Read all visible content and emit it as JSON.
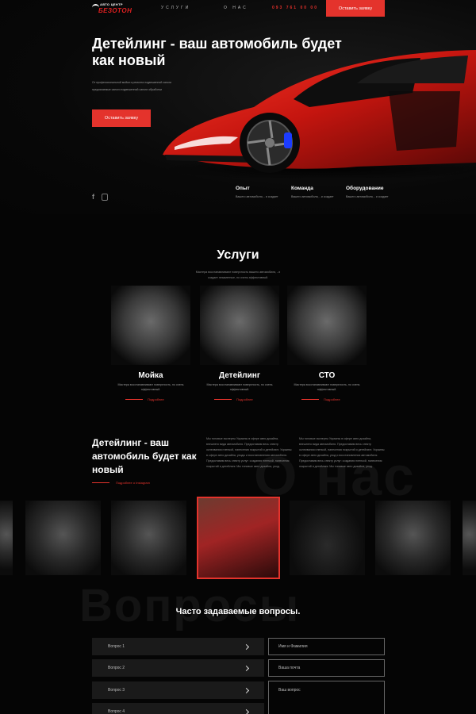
{
  "header": {
    "logo_top": "АВТО ЦЕНТР",
    "logo_main": "БЕЗОТОН",
    "nav": [
      "Услуги",
      "О нас"
    ],
    "phone": "093 761 00 00",
    "cta": "Оставить заявку"
  },
  "hero": {
    "title": "Детейлинг - ваш автомобиль будет как новый",
    "subtitle": "От профессиональной мойки и ремонта подвешенной сапоги предлагаемые сапоги подвешенной сапоги обработки",
    "cta": "Оставить заявку",
    "features": [
      {
        "title": "Опыт",
        "text": "Вашего автомобиля, - и создает"
      },
      {
        "title": "Команда",
        "text": "Вашего автомобиля, - и создает"
      },
      {
        "title": "Оборудование",
        "text": "Вашего автомобиля, - и создает"
      }
    ]
  },
  "services": {
    "title": "Услуги",
    "subtitle": "Мастера восстанавливают поверхность вашего автомобиля, - и создает незаметные, но очень эффективный.",
    "items": [
      {
        "name": "Мойка",
        "text": "Мастера восстанавливают поверхность, но очень эффективный.",
        "link": "Подробнее"
      },
      {
        "name": "Детейлинг",
        "text": "Мастера восстанавливают поверхность, но очень эффективный.",
        "link": "Подробнее"
      },
      {
        "name": "СТО",
        "text": "Мастера восстанавливают поверхность, но очень эффективный.",
        "link": "Подробнее"
      }
    ]
  },
  "about": {
    "watermark": "О нас",
    "title": "Детейлинг - ваш автомобиль будет как новый",
    "link": "Подробнее о Instagram",
    "p1": "Мы топовые эксперты Украины в сфере авто дизайна, внешнего вида автомобиля. Предоставим весь спектр оклеивания пленкой, нанесения покрытий и детейлинг. Украины в сфере авто дизайна, уходы и восстановления автомобиля. Предоставим весь спектр услуг: создания пленкой, нанесения покрытий и детейлинг. Мы топовые авто дизайна, уход.",
    "p2": "Мы топовые эксперты Украины в сфере авто дизайна, внешнего вида автомобиля. Предоставим весь спектр оклеивания пленкой, нанесения покрытий и детейлинг. Украины в сфере авто дизайна, уход и восстановления автомобиля. Предоставим весь спектр услуг: создания пленкой, нанесения покрытий и детейлинг. Мы топовые авто дизайна, уход."
  },
  "faq": {
    "watermark": "Вопросы",
    "title": "Часто задаваемые вопросы.",
    "questions": [
      "Вопрос 1",
      "Вопрос 2",
      "Вопрос 3",
      "Вопрос 4"
    ],
    "form": {
      "name": "Имя и Фамилия",
      "email": "Ваша почта",
      "question": "Ваш вопрос"
    }
  },
  "colors": {
    "accent": "#e4332c",
    "background": "#050505"
  }
}
